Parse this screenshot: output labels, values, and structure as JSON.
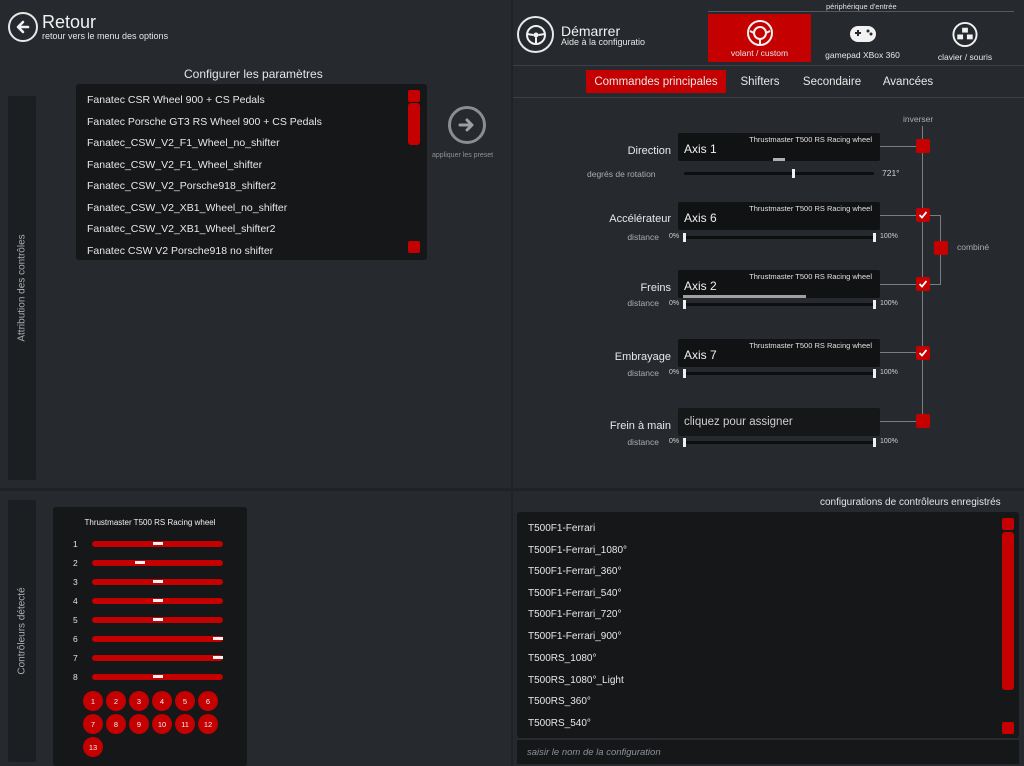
{
  "header": {
    "back_title": "Retour",
    "back_subtitle": "retour vers le menu des options",
    "start_title": "Démarrer",
    "start_subtitle": "Aide à la configuratio",
    "device_caption": "périphérique d'entrée"
  },
  "devices": [
    {
      "label": "volant / custom",
      "icon": "steering-wheel-icon",
      "active": true
    },
    {
      "label": "gamepad XBox 360",
      "icon": "gamepad-icon",
      "active": false
    },
    {
      "label": "clavier / souris",
      "icon": "keyboard-mouse-icon",
      "active": false
    }
  ],
  "tabs": [
    {
      "label": "Commandes principales",
      "active": true
    },
    {
      "label": "Shifters",
      "active": false
    },
    {
      "label": "Secondaire",
      "active": false
    },
    {
      "label": "Avancées",
      "active": false
    }
  ],
  "left_tab": "Attribution des contrôles",
  "bottom_left_tab": "Contrôleurs détecté",
  "presets": {
    "title": "Configurer les paramètres",
    "apply_label": "appliquer les preset",
    "items": [
      "Fanatec CSR Wheel 900 + CS Pedals",
      "Fanatec Porsche GT3 RS Wheel 900 + CS Pedals",
      "Fanatec_CSW_V2_F1_Wheel_no_shifter",
      "Fanatec_CSW_V2_F1_Wheel_shifter",
      "Fanatec_CSW_V2_Porsche918_shifter2",
      "Fanatec_CSW_V2_XB1_Wheel_no_shifter",
      "Fanatec_CSW_V2_XB1_Wheel_shifter2",
      "Fanatec CSW V2 Porsche918 no shifter"
    ]
  },
  "controls": {
    "invert_label": "inverser",
    "combined_label": "combiné",
    "direction": {
      "label": "Direction",
      "device": "Thrustmaster T500 RS Racing wheel",
      "axis": "Axis 1",
      "rotation_label": "degrés de rotation",
      "rotation_value": "721°",
      "rotation_fraction": 0.57
    },
    "accel": {
      "label": "Accélérateur",
      "device": "Thrustmaster T500 RS Racing wheel",
      "axis": "Axis 6",
      "distance_label": "distance",
      "min": "0%",
      "max": "100%"
    },
    "brake": {
      "label": "Freins",
      "device": "Thrustmaster T500 RS Racing wheel",
      "axis": "Axis 2",
      "distance_label": "distance",
      "min": "0%",
      "max": "100%"
    },
    "clutch": {
      "label": "Embrayage",
      "device": "Thrustmaster T500 RS Racing wheel",
      "axis": "Axis 7",
      "distance_label": "distance",
      "min": "0%",
      "max": "100%"
    },
    "handbrake": {
      "label": "Frein à main",
      "axis": "cliquez pour assigner",
      "distance_label": "distance",
      "min": "0%",
      "max": "100%"
    }
  },
  "detected": {
    "device": "Thrustmaster T500 RS Racing wheel",
    "axes": [
      {
        "num": "1",
        "pos": 0.5
      },
      {
        "num": "2",
        "pos": 0.37
      },
      {
        "num": "3",
        "pos": 0.5
      },
      {
        "num": "4",
        "pos": 0.5
      },
      {
        "num": "5",
        "pos": 0.5
      },
      {
        "num": "6",
        "pos": 0.96
      },
      {
        "num": "7",
        "pos": 0.96
      },
      {
        "num": "8",
        "pos": 0.5
      }
    ],
    "buttons": [
      "1",
      "2",
      "3",
      "4",
      "5",
      "6",
      "7",
      "8",
      "9",
      "10",
      "11",
      "12",
      "13"
    ]
  },
  "saved": {
    "title": "configurations de contrôleurs enregistrés",
    "items": [
      "T500F1-Ferrari",
      "T500F1-Ferrari_1080°",
      "T500F1-Ferrari_360°",
      "T500F1-Ferrari_540°",
      "T500F1-Ferrari_720°",
      "T500F1-Ferrari_900°",
      "T500RS_1080°",
      "T500RS_1080°_Light",
      "T500RS_360°",
      "T500RS_540°"
    ],
    "input_placeholder": "saisir le nom de la configuration"
  },
  "colors": {
    "accent": "#c40000",
    "panel": "#26292d",
    "box": "#151719"
  }
}
